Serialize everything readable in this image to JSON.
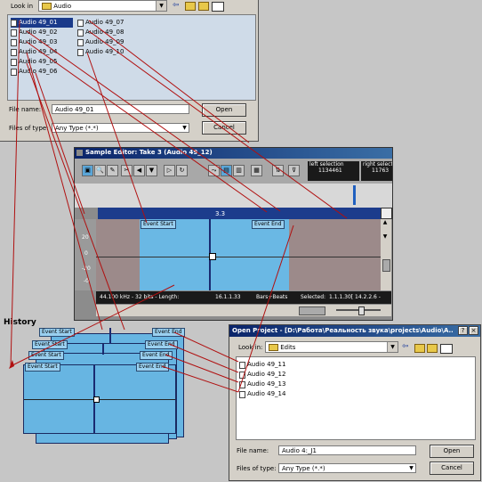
{
  "open_dialog_1": {
    "look_in_label": "Look in",
    "look_in_value": "Audio",
    "files_col1": [
      "Audio 49_01",
      "Audio 49_02",
      "Audio 49_03",
      "Audio 49_04",
      "Audio 49_05",
      "Audio 49_06"
    ],
    "files_col2": [
      "Audio 49_07",
      "Audio 49_08",
      "Audio 49_09",
      "Audio 49_10"
    ],
    "file_name_label": "File name:",
    "file_name_value": "Audio 49_01",
    "files_of_type_label": "Files of type:",
    "files_of_type_value": "Any Type (*.*)",
    "open_button": "Open",
    "cancel_button": "Cancel"
  },
  "sample_editor": {
    "title": "Sample Editor: Take 3 (Audio 49_12)",
    "left_selection_label": "left selection",
    "left_selection_value": "1134461",
    "right_selection_label": "right select",
    "right_selection_value": "11763",
    "ruler_marker": "3.3",
    "scale_labels": [
      "20",
      "0",
      "-20",
      "-0"
    ],
    "event_start": "Event Start",
    "event_end": "Event End",
    "status_format": "44.100 kHz - 32 bits - Length:",
    "status_length": "16.1.1.33",
    "status_mode": "Bars+Beats",
    "status_selected_label": "Selected:",
    "status_selected_value": "1.1.1.30[   14.2.2.6 -"
  },
  "history": {
    "label": "History",
    "event_start_labels": [
      "Event Start",
      "Event Start",
      "Event Start",
      "Event Start"
    ],
    "event_end_labels": [
      "Event End",
      "Event End",
      "Event End",
      "Event End"
    ]
  },
  "open_project": {
    "title": "Open Project - [D:\\Работа\\Реальность звука\\projects\\Audio\\A...",
    "help_button": "?",
    "close_button": "×",
    "look_in_label": "Look in:",
    "look_in_value": "Edits",
    "files": [
      "Audio 49_11",
      "Audio 49_12",
      "Audio 49_13",
      "Audio 49_14"
    ],
    "file_name_label": "File name:",
    "file_name_value": "Audio 4:_J1",
    "files_of_type_label": "Files of type:",
    "files_of_type_value": "Any Type (*.*)",
    "open_button": "Open",
    "cancel_button": "Cancel"
  },
  "colors": {
    "dialog_bg": "#d4d0c8",
    "list_bg": "#cfdbe8",
    "title_active": "#0a246a",
    "waveform_selected": "#6ab8e4",
    "waveform_unselected": "#9c8a8a",
    "annotation_arrow": "#b01010"
  }
}
